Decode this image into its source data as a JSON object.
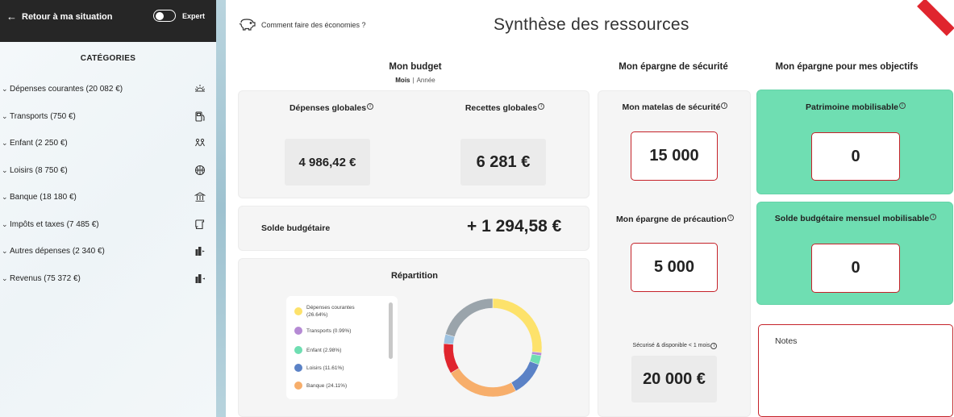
{
  "sidebar": {
    "back_label": "Retour à ma situation",
    "expert_label": "Expert",
    "expert_enabled": false,
    "categories_title": "CATÉGORIES",
    "items": [
      {
        "label": "Dépenses courantes (20 082 €)",
        "icon": "sun-icon"
      },
      {
        "label": "Transports (750 €)",
        "icon": "fuel-pump-icon"
      },
      {
        "label": "Enfant (2 250 €)",
        "icon": "children-icon"
      },
      {
        "label": "Loisirs (8 750 €)",
        "icon": "basketball-icon"
      },
      {
        "label": "Banque (18 180 €)",
        "icon": "bank-icon"
      },
      {
        "label": "Impôts et taxes (7 485 €)",
        "icon": "document-icon"
      },
      {
        "label": "Autres dépenses (2 340 €)",
        "icon": "building-out-icon"
      },
      {
        "label": "Revenus (75 372 €)",
        "icon": "building-in-icon"
      }
    ]
  },
  "header": {
    "tips_label": "Comment faire des économies ?",
    "title": "Synthèse des ressources"
  },
  "budget": {
    "title": "Mon budget",
    "period_month": "Mois",
    "period_separator": "|",
    "period_year": "Année",
    "depenses_label": "Dépenses globales",
    "depenses_value": "4 986,42 €",
    "recettes_label": "Recettes globales",
    "recettes_value": "6 281 €",
    "solde_label": "Solde budgétaire",
    "solde_value": "+ 1 294,58 €",
    "repartition_title": "Répartition"
  },
  "chart_data": {
    "type": "pie",
    "donut": true,
    "categories": [
      "Dépenses courantes",
      "Transports",
      "Enfant",
      "Loisirs",
      "Banque",
      "Impôts et taxes",
      "Autres dépenses",
      "Revenus"
    ],
    "values": [
      26.64,
      0.99,
      2.98,
      11.61,
      24.11,
      10.0,
      3.1,
      20.57
    ],
    "colors": [
      "#fde26b",
      "#b58ad4",
      "#6fdeb2",
      "#5b82c6",
      "#f7ae6b",
      "#e0252e",
      "#9ec2e0",
      "#9aa4ab"
    ],
    "legend": [
      {
        "label": "Dépenses courantes (26.64%)",
        "color": "#fde26b"
      },
      {
        "label": "Transports (0.99%)",
        "color": "#b58ad4"
      },
      {
        "label": "Enfant (2.98%)",
        "color": "#6fdeb2"
      },
      {
        "label": "Loisirs (11.61%)",
        "color": "#5b82c6"
      },
      {
        "label": "Banque (24.11%)",
        "color": "#f7ae6b"
      }
    ]
  },
  "securite": {
    "title": "Mon épargne de sécurité",
    "matelas_label": "Mon matelas de sécurité",
    "matelas_value": "15 000",
    "precaution_label": "Mon épargne de précaution",
    "precaution_value": "5 000",
    "disponible_label": "Sécurisé & disponible < 1 mois",
    "disponible_value": "20 000 €"
  },
  "objectifs": {
    "title": "Mon épargne pour mes objectifs",
    "patrimoine_label": "Patrimoine mobilisable",
    "patrimoine_value": "0",
    "solde_mensuel_label": "Solde budgétaire mensuel mobilisable",
    "solde_mensuel_value": "0",
    "notes_label": "Notes"
  }
}
